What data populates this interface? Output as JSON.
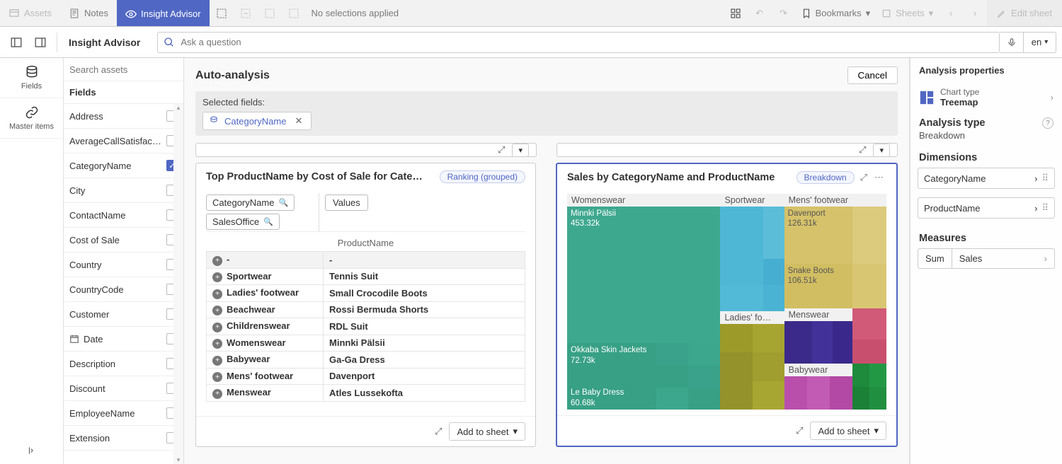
{
  "topbar": {
    "assets": "Assets",
    "notes": "Notes",
    "insight_advisor": "Insight Advisor",
    "no_selections": "No selections applied",
    "bookmarks": "Bookmarks",
    "sheets": "Sheets",
    "edit_sheet": "Edit sheet"
  },
  "secondbar": {
    "title": "Insight Advisor",
    "placeholder": "Ask a question",
    "lang": "en"
  },
  "rail": {
    "fields": "Fields",
    "master_items": "Master items"
  },
  "fields_panel": {
    "search_placeholder": "Search assets",
    "header": "Fields",
    "items": [
      {
        "label": "Address",
        "checked": false
      },
      {
        "label": "AverageCallSatisfac…",
        "checked": false
      },
      {
        "label": "CategoryName",
        "checked": true
      },
      {
        "label": "City",
        "checked": false
      },
      {
        "label": "ContactName",
        "checked": false
      },
      {
        "label": "Cost of Sale",
        "checked": false
      },
      {
        "label": "Country",
        "checked": false
      },
      {
        "label": "CountryCode",
        "checked": false
      },
      {
        "label": "Customer",
        "checked": false
      },
      {
        "label": "Date",
        "checked": false,
        "icon": "date"
      },
      {
        "label": "Description",
        "checked": false
      },
      {
        "label": "Discount",
        "checked": false
      },
      {
        "label": "EmployeeName",
        "checked": false
      },
      {
        "label": "Extension",
        "checked": false
      }
    ]
  },
  "workspace": {
    "auto_analysis": "Auto-analysis",
    "cancel": "Cancel",
    "selected_fields_label": "Selected fields:",
    "selected_field": "CategoryName",
    "add_to_sheet": "Add to sheet"
  },
  "card1": {
    "title": "Top ProductName by Cost of Sale for Cate…",
    "badge": "Ranking (grouped)",
    "pivot_dim1": "CategoryName",
    "pivot_dim2": "SalesOffice",
    "values": "Values",
    "product_header": "ProductName",
    "rows": [
      {
        "cat": "-",
        "prod": "-",
        "first": true
      },
      {
        "cat": "Sportwear",
        "prod": "Tennis Suit"
      },
      {
        "cat": "Ladies' footwear",
        "prod": "Small Crocodile Boots"
      },
      {
        "cat": "Beachwear",
        "prod": "Rossi Bermuda Shorts"
      },
      {
        "cat": "Childrenswear",
        "prod": "RDL Suit"
      },
      {
        "cat": "Womenswear",
        "prod": "Minnki Pälsii"
      },
      {
        "cat": "Babywear",
        "prod": "Ga-Ga Dress"
      },
      {
        "cat": "Mens' footwear",
        "prod": "Davenport"
      },
      {
        "cat": "Menswear",
        "prod": "Atles Lussekofta"
      }
    ]
  },
  "card2": {
    "title": "Sales by CategoryName and ProductName",
    "badge": "Breakdown",
    "categories": {
      "womenswear": "Womenswear",
      "sportwear": "Sportwear",
      "mensfootwear": "Mens' footwear",
      "ladiesfootwear": "Ladies' fo…",
      "menswear": "Menswear",
      "babywear": "Babywear"
    },
    "labels": {
      "minnki": {
        "name": "Minnki Pälsii",
        "val": "453.32k"
      },
      "okkaba": {
        "name": "Okkaba Skin Jackets",
        "val": "72.73k"
      },
      "lebaby": {
        "name": "Le Baby Dress",
        "val": "60.68k"
      },
      "davenport": {
        "name": "Davenport",
        "val": "126.31k"
      },
      "snakeboots": {
        "name": "Snake Boots",
        "val": "106.51k"
      }
    }
  },
  "chart_data": {
    "type": "treemap",
    "title": "Sales by CategoryName and ProductName",
    "hierarchy": [
      "CategoryName",
      "ProductName"
    ],
    "measure": "Sales",
    "note": "Only leaf values visibly labeled in the image are captured; other leaf rectangles are rendered without labels in the screenshot.",
    "categories": [
      {
        "name": "Womenswear",
        "children": [
          {
            "name": "Minnki Pälsii",
            "value": 453320
          },
          {
            "name": "Okkaba Skin Jackets",
            "value": 72730
          },
          {
            "name": "Le Baby Dress",
            "value": 60680
          }
        ]
      },
      {
        "name": "Sportwear",
        "children": []
      },
      {
        "name": "Mens' footwear",
        "children": [
          {
            "name": "Davenport",
            "value": 126310
          },
          {
            "name": "Snake Boots",
            "value": 106510
          }
        ]
      },
      {
        "name": "Ladies' footwear",
        "children": []
      },
      {
        "name": "Menswear",
        "children": []
      },
      {
        "name": "Babywear",
        "children": []
      }
    ]
  },
  "props": {
    "header": "Analysis properties",
    "chart_type_label": "Chart type",
    "chart_type": "Treemap",
    "analysis_type_label": "Analysis type",
    "analysis_type": "Breakdown",
    "dimensions_label": "Dimensions",
    "dim1": "CategoryName",
    "dim2": "ProductName",
    "measures_label": "Measures",
    "agg": "Sum",
    "measure": "Sales"
  }
}
